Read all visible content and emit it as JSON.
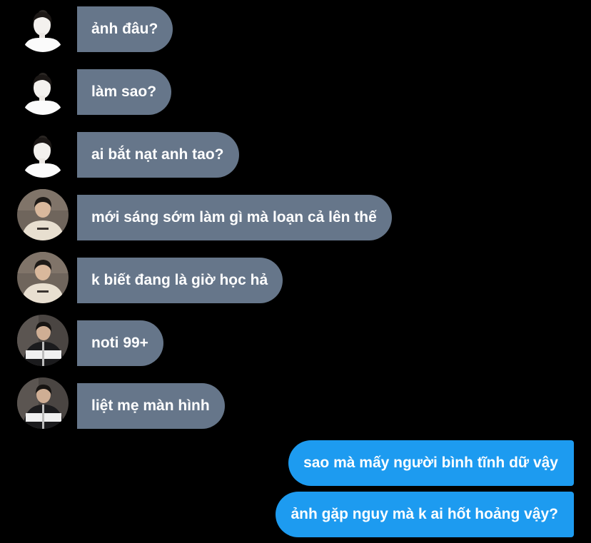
{
  "colors": {
    "background": "#000000",
    "incoming_bubble": "#66768a",
    "outgoing_bubble": "#1d9bf0",
    "text": "#ffffff"
  },
  "messages": [
    {
      "direction": "incoming",
      "sender_avatar": "avatar-white-shirt-girl",
      "text": "ảnh đâu?"
    },
    {
      "direction": "incoming",
      "sender_avatar": "avatar-white-shirt-girl",
      "text": "làm sao?"
    },
    {
      "direction": "incoming",
      "sender_avatar": "avatar-white-shirt-girl",
      "text": "ai bắt nạt anh tao?"
    },
    {
      "direction": "incoming",
      "sender_avatar": "avatar-cream-shirt-boy",
      "text": "mới sáng sớm làm gì mà loạn cả lên thế"
    },
    {
      "direction": "incoming",
      "sender_avatar": "avatar-cream-shirt-boy",
      "text": "k biết đang là giờ học hả"
    },
    {
      "direction": "incoming",
      "sender_avatar": "avatar-dark-jacket-boy",
      "text": "noti 99+"
    },
    {
      "direction": "incoming",
      "sender_avatar": "avatar-dark-jacket-boy",
      "text": "liệt mẹ màn hình"
    },
    {
      "direction": "outgoing",
      "text": "sao mà mấy người bình tĩnh dữ vậy"
    },
    {
      "direction": "outgoing",
      "text": "ảnh gặp nguy mà k ai hốt hoảng vậy?"
    }
  ]
}
